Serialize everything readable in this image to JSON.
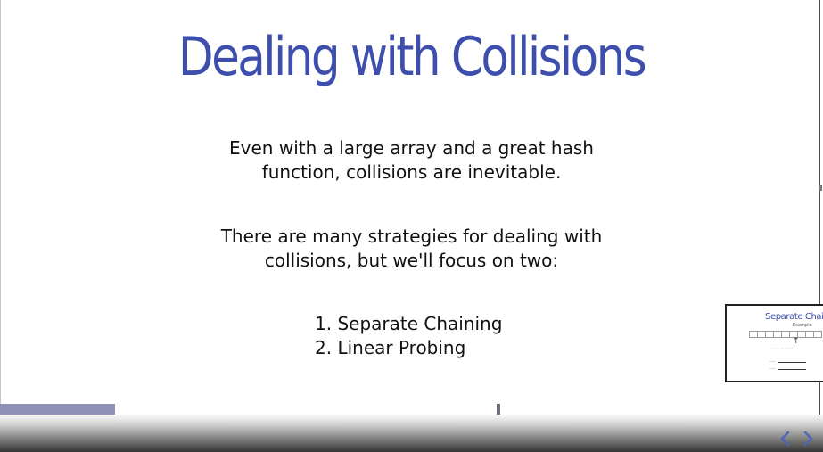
{
  "slide": {
    "title": "Dealing with Collisions",
    "paragraph1": [
      "Even with a large array and a great hash",
      "function, collisions are inevitable."
    ],
    "paragraph2": [
      "There are many strategies for dealing with",
      "collisions, but we'll focus on two:"
    ],
    "strategies": [
      "1. Separate Chaining",
      "2. Linear Probing"
    ]
  },
  "thumbnail": {
    "title": "Separate Chaini",
    "subtitle": "Example"
  },
  "player": {
    "progress_fraction": 0.14,
    "prev_icon": "chevron-left-icon",
    "next_icon": "chevron-right-icon"
  },
  "colors": {
    "title": "#3d4eac",
    "progress": "#8f92b6"
  }
}
